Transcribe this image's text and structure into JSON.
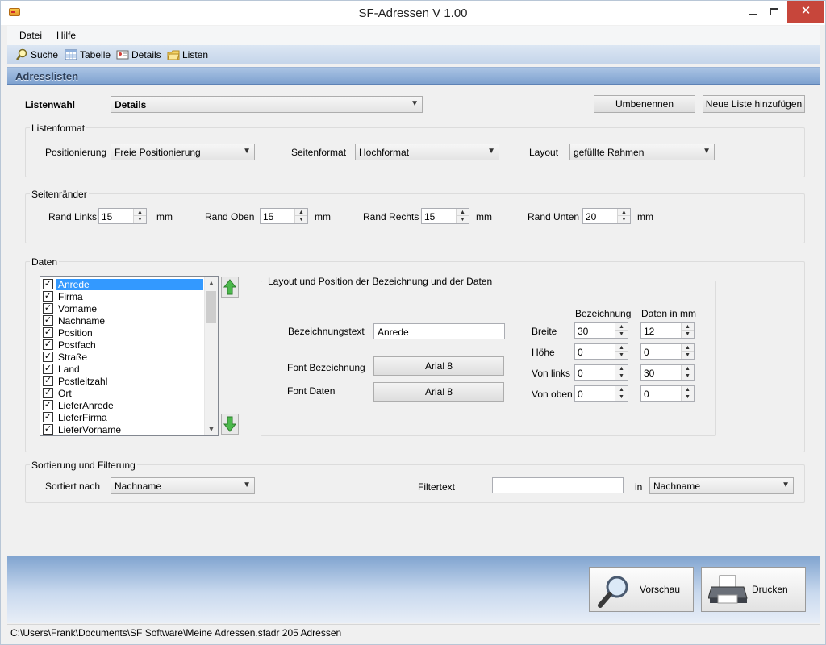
{
  "window": {
    "title": "SF-Adressen  V 1.00",
    "close_glyph": "✕"
  },
  "menu": {
    "items": [
      "Datei",
      "Hilfe"
    ]
  },
  "toolbar": {
    "items": [
      {
        "label": "Suche",
        "icon": "search-icon"
      },
      {
        "label": "Tabelle",
        "icon": "table-icon"
      },
      {
        "label": "Details",
        "icon": "details-icon"
      },
      {
        "label": "Listen",
        "icon": "lists-icon"
      }
    ]
  },
  "section": {
    "title": "Adresslisten"
  },
  "listenwahl": {
    "label": "Listenwahl",
    "selected": "Details",
    "rename_label": "Umbenennen",
    "add_label": "Neue Liste hinzufügen"
  },
  "listenformat": {
    "title": "Listenformat",
    "positionierung_label": "Positionierung",
    "positionierung_value": "Freie Positionierung",
    "seitenformat_label": "Seitenformat",
    "seitenformat_value": "Hochformat",
    "layout_label": "Layout",
    "layout_value": "gefüllte Rahmen"
  },
  "seitenraender": {
    "title": "Seitenränder",
    "unit": "mm",
    "links_label": "Rand Links",
    "links_value": "15",
    "oben_label": "Rand Oben",
    "oben_value": "15",
    "rechts_label": "Rand Rechts",
    "rechts_value": "15",
    "unten_label": "Rand Unten",
    "unten_value": "20"
  },
  "daten": {
    "title": "Daten",
    "fields": [
      "Anrede",
      "Firma",
      "Vorname",
      "Nachname",
      "Position",
      "Postfach",
      "Straße",
      "Land",
      "Postleitzahl",
      "Ort",
      "LieferAnrede",
      "LieferFirma",
      "LieferVorname"
    ],
    "selected_field": "Anrede",
    "check_glyph": "✓",
    "layout_title": "Layout und Position der Bezeichnung und der Daten",
    "bezeichnungstext_label": "Bezeichnungstext",
    "bezeichnungstext_value": "Anrede",
    "font_bezeichnung_label": "Font Bezeichnung",
    "font_bezeichnung_value": "Arial 8",
    "font_daten_label": "Font Daten",
    "font_daten_value": "Arial 8",
    "col_bezeichnung": "Bezeichnung",
    "col_daten": "Daten in mm",
    "rows": [
      {
        "label": "Breite",
        "bezeichnung": "30",
        "daten": "12"
      },
      {
        "label": "Höhe",
        "bezeichnung": "0",
        "daten": "0"
      },
      {
        "label": "Von links",
        "bezeichnung": "0",
        "daten": "30"
      },
      {
        "label": "Von oben",
        "bezeichnung": "0",
        "daten": "0"
      }
    ]
  },
  "sortierung": {
    "title": "Sortierung und Filterung",
    "sortiert_label": "Sortiert nach",
    "sortiert_value": "Nachname",
    "filter_label": "Filtertext",
    "filter_value": "",
    "in_label": "in",
    "in_value": "Nachname"
  },
  "actions": {
    "preview_label": "Vorschau",
    "print_label": "Drucken"
  },
  "status": {
    "text": "C:\\Users\\Frank\\Documents\\SF Software\\Meine Adressen.sfadr  205 Adressen"
  },
  "colors": {
    "selection": "#3399ff",
    "header_gradient_top": "#a9c3e3",
    "close_button": "#c7463b",
    "arrow_green": "#3aa53a"
  }
}
